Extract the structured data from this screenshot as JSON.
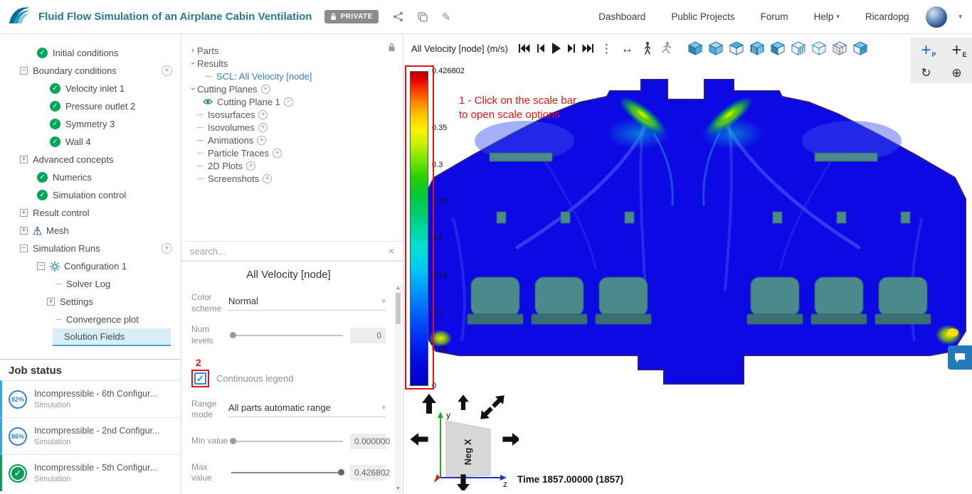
{
  "icons": {
    "check": "✓",
    "plus": "+",
    "minus": "−",
    "chevron": "›",
    "dropdown": "▾",
    "dots_menu": "⋮",
    "pan": "↔",
    "clear": "×",
    "rotate": "↻",
    "target": "⊕",
    "pencil": "✎"
  },
  "header": {
    "title": "Fluid Flow Simulation of an Airplane Cabin Ventilation",
    "private_badge": "PRIVATE",
    "nav": [
      {
        "label": "Dashboard"
      },
      {
        "label": "Public Projects"
      },
      {
        "label": "Forum"
      },
      {
        "label": "Help"
      }
    ],
    "username": "Ricardopg"
  },
  "sim_tree": {
    "items": [
      {
        "label": "Initial conditions",
        "status": "complete"
      },
      {
        "label": "Boundary conditions",
        "expanded": true,
        "can_add": true
      },
      {
        "label": "Velocity inlet 1",
        "status": "complete"
      },
      {
        "label": "Pressure outlet 2",
        "status": "complete"
      },
      {
        "label": "Symmetry 3",
        "status": "complete"
      },
      {
        "label": "Wall 4",
        "status": "complete"
      },
      {
        "label": "Advanced concepts",
        "expanded": false
      },
      {
        "label": "Numerics",
        "status": "complete"
      },
      {
        "label": "Simulation control",
        "status": "complete"
      },
      {
        "label": "Result control",
        "expanded": false
      },
      {
        "label": "Mesh",
        "expanded": false
      },
      {
        "label": "Simulation Runs",
        "expanded": true,
        "can_add": true
      },
      {
        "label": "Configuration 1",
        "expanded": true
      },
      {
        "label": "Solver Log"
      },
      {
        "label": "Settings",
        "expanded": false
      },
      {
        "label": "Convergence plot"
      },
      {
        "label": "Solution Fields",
        "selected": true
      }
    ]
  },
  "job_status": {
    "title": "Job status",
    "jobs": [
      {
        "progress": "82%",
        "name": "Incompressible - 6th Configur...",
        "type": "Simulation",
        "status": "running"
      },
      {
        "progress": "86%",
        "name": "Incompressible - 2nd Configur...",
        "type": "Simulation",
        "status": "running"
      },
      {
        "progress": "100%",
        "name": "Incompressible - 5th Configur...",
        "type": "Simulation",
        "status": "finished"
      }
    ]
  },
  "post_tree": {
    "items": [
      {
        "label": "Parts"
      },
      {
        "label": "Results",
        "expanded": true
      },
      {
        "label": "SCL: All Velocity [node]",
        "selected": true
      },
      {
        "label": "Cutting Planes",
        "expanded": true
      },
      {
        "label": "Cutting Plane 1",
        "visible": true
      },
      {
        "label": "Isosurfaces"
      },
      {
        "label": "Isovolumes"
      },
      {
        "label": "Animations"
      },
      {
        "label": "Particle Traces"
      },
      {
        "label": "2D Plots"
      },
      {
        "label": "Screenshots"
      }
    ],
    "search_placeholder": "search..."
  },
  "properties": {
    "title": "All Velocity [node]",
    "color_scheme": {
      "label": "Color scheme",
      "value": "Normal"
    },
    "num_levels": {
      "label": "Num levels",
      "value": "0"
    },
    "continuous_legend": {
      "label": "Continuous legend",
      "checked": true
    },
    "range_mode": {
      "label": "Range mode",
      "value": "All parts automatic range"
    },
    "min_value": {
      "label": "Min value",
      "value": "0.000000"
    },
    "max_value": {
      "label": "Max value",
      "value": "0.426802"
    }
  },
  "annotations": {
    "step1_line1": "1 - Click on the scale bar",
    "step1_line2": "to open scale options",
    "step2": "2",
    "color": "#e31414"
  },
  "viewport": {
    "field_label": "All Velocity [node] (m/s)",
    "time_label": "Time 1857.00000 (1857)",
    "probe_point_letter": "P",
    "probe_element_letter": "E",
    "scale_labels": [
      "0.426802",
      "0.35",
      "0.3",
      "0.25",
      "0.2",
      "0.15",
      "0.1",
      "0.05",
      "0"
    ],
    "scale_max": 0.426802,
    "scale_min": 0,
    "axes": {
      "up": "y",
      "right": "z",
      "face": "Neg X"
    }
  },
  "colors": {
    "accent_teal": "#27798e",
    "selected_blue": "#42a8d8",
    "annotation_red": "#e31414",
    "check_green": "#00a65a",
    "link_blue": "#3a7dbd"
  }
}
